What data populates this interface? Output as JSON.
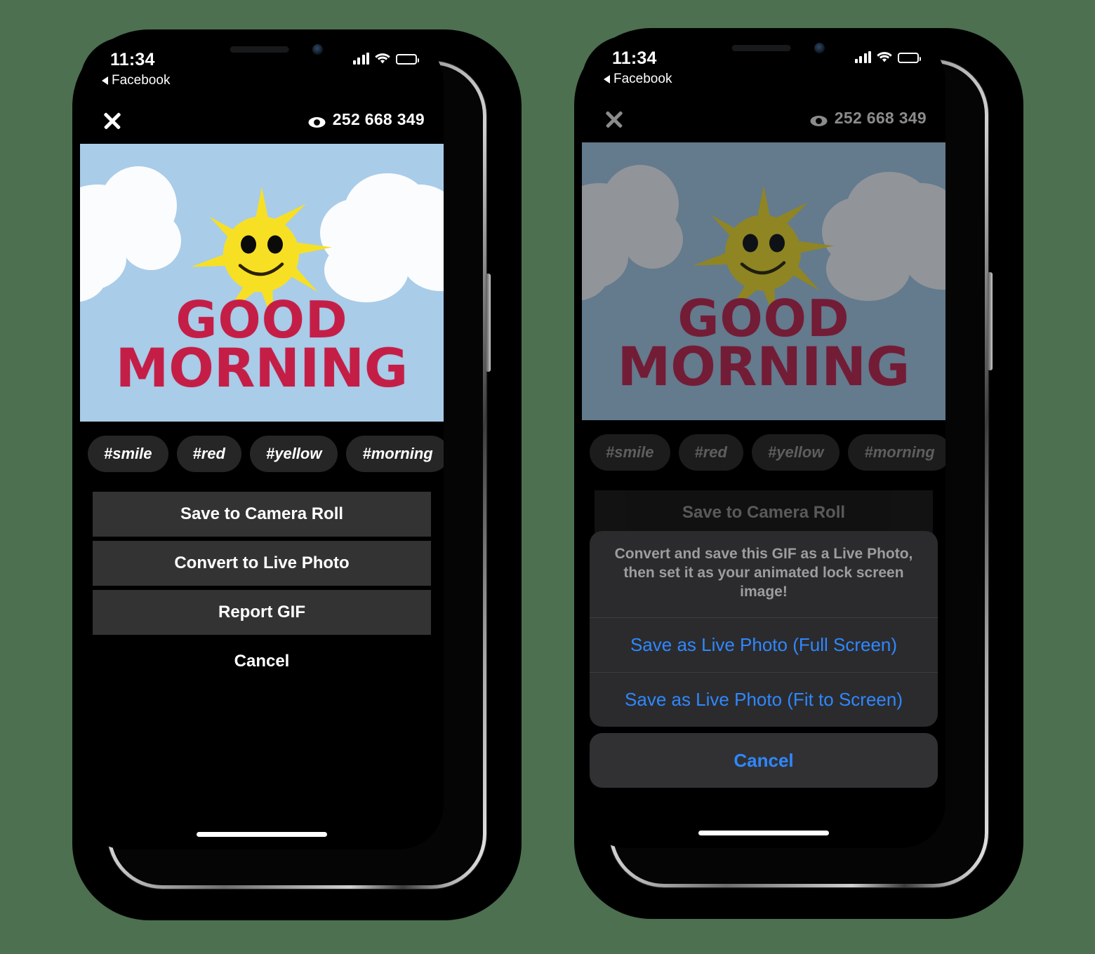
{
  "background_color": "#4c7050",
  "status_bar": {
    "time": "11:34",
    "back_app": "Facebook",
    "signal_icon": "cellular-signal-icon",
    "wifi_icon": "wifi-icon",
    "battery_icon": "battery-icon"
  },
  "topbar": {
    "close_icon": "close-icon",
    "eye_icon": "eye-icon",
    "view_count": "252 668 349"
  },
  "gif": {
    "alt_text": "GOOD MORNING",
    "line1": "GOOD",
    "line2": "MORNING",
    "sky_color": "#a9cce8",
    "cloud_color": "#fbfcfd",
    "sun_color": "#f7e024",
    "text_color": "#c41e47"
  },
  "tags": [
    {
      "label": "#smile"
    },
    {
      "label": "#red"
    },
    {
      "label": "#yellow"
    },
    {
      "label": "#morning"
    },
    {
      "label": "#"
    }
  ],
  "left_phone": {
    "actions": [
      {
        "label": "Save to Camera Roll"
      },
      {
        "label": "Convert to Live Photo"
      },
      {
        "label": "Report GIF"
      }
    ],
    "cancel_label": "Cancel"
  },
  "right_phone": {
    "sheet": {
      "message": "Convert and save this GIF as a Live Photo, then set it as your animated lock screen image!",
      "items": [
        {
          "label": "Save as Live Photo (Full Screen)"
        },
        {
          "label": "Save as Live Photo (Fit to Screen)"
        }
      ],
      "cancel_label": "Cancel",
      "accent_color": "#2f87ff"
    }
  }
}
